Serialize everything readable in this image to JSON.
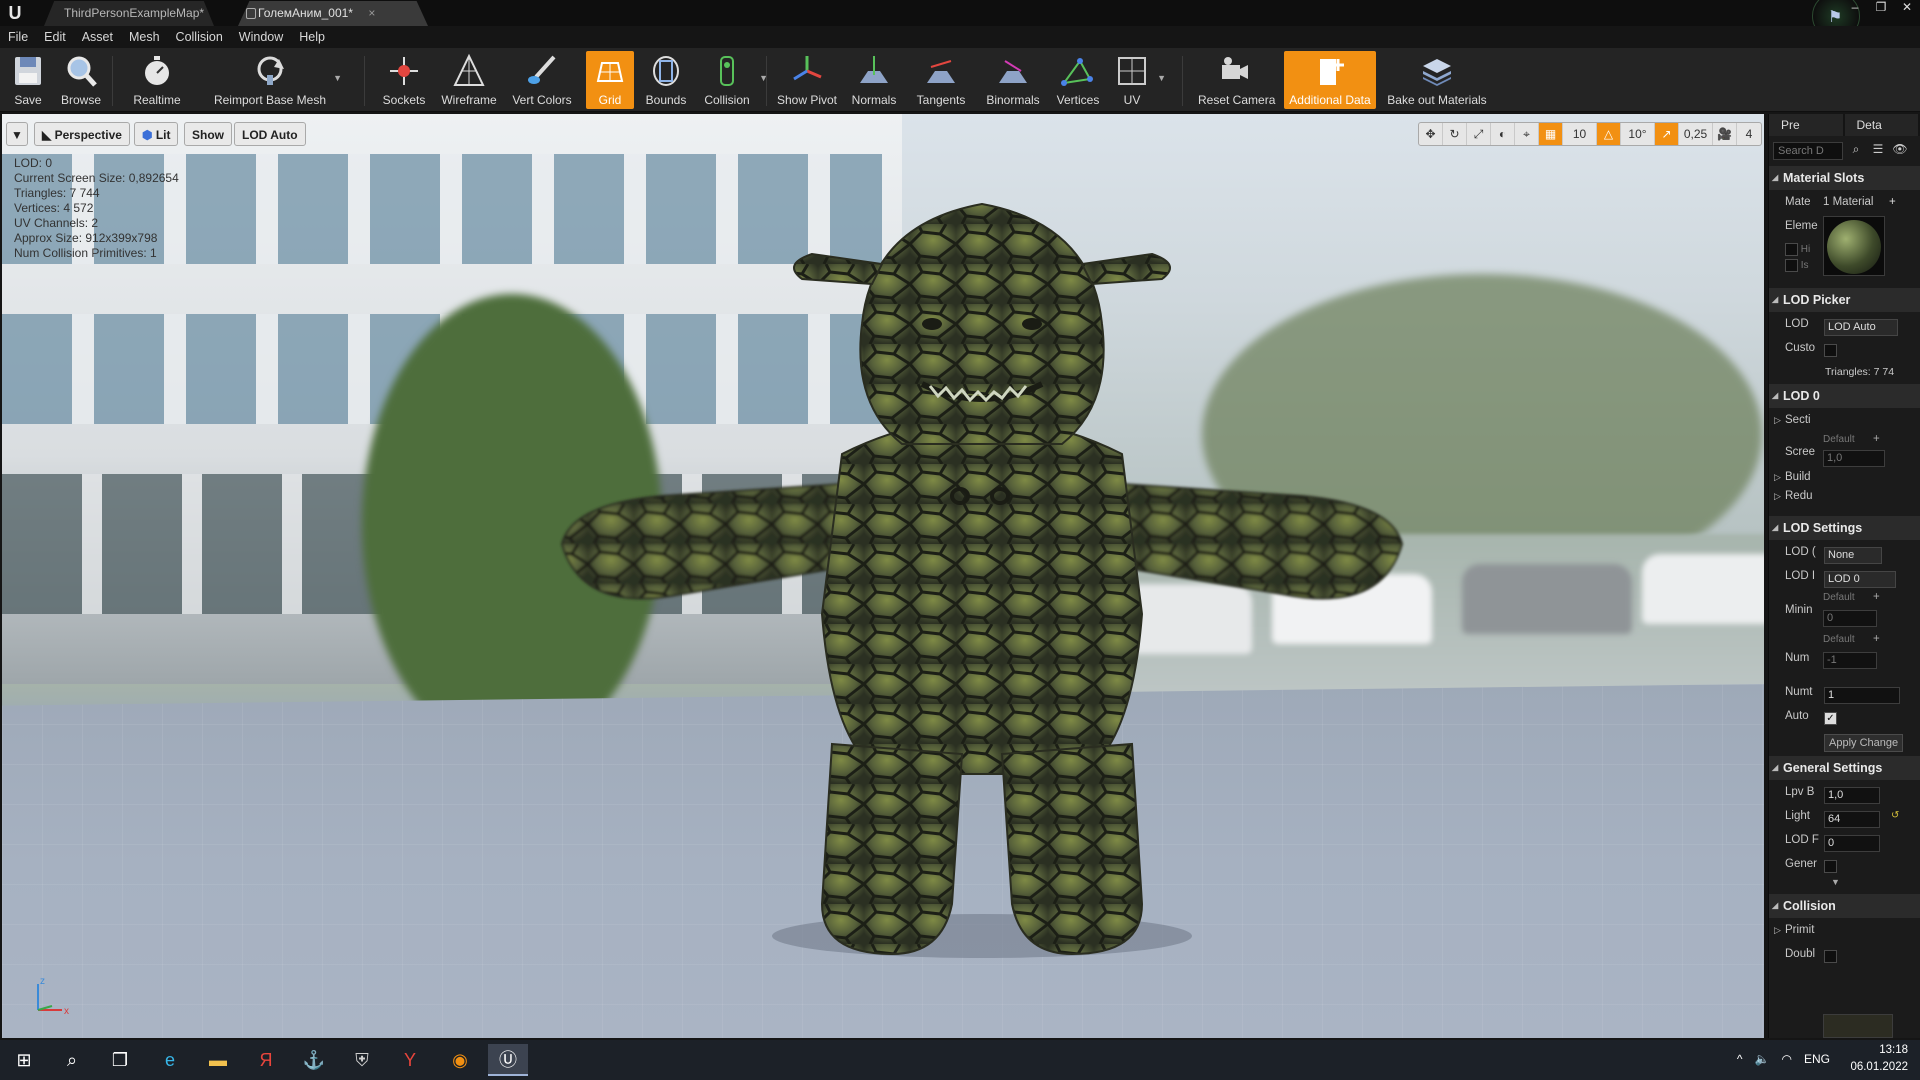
{
  "tabs": [
    {
      "label": "ThirdPersonExampleMap*"
    },
    {
      "label": "ГолемАним_001*"
    }
  ],
  "menu": [
    "File",
    "Edit",
    "Asset",
    "Mesh",
    "Collision",
    "Window",
    "Help"
  ],
  "toolbar": {
    "save": "Save",
    "browse": "Browse",
    "realtime": "Realtime",
    "reimport": "Reimport Base Mesh",
    "sockets": "Sockets",
    "wireframe": "Wireframe",
    "vert_colors": "Vert Colors",
    "grid": "Grid",
    "bounds": "Bounds",
    "collision": "Collision",
    "show_pivot": "Show Pivot",
    "normals": "Normals",
    "tangents": "Tangents",
    "binormals": "Binormals",
    "vertices": "Vertices",
    "uv": "UV",
    "reset_camera": "Reset Camera",
    "additional_data": "Additional Data",
    "bake_out": "Bake out Materials",
    "active_color": "#f29012"
  },
  "viewport": {
    "perspective": "Perspective",
    "lit": "Lit",
    "show": "Show",
    "lod_auto": "LOD Auto",
    "grid_snap": "10",
    "rot_snap": "10°",
    "scale_snap": "0,25",
    "camera_speed": "4",
    "stats": [
      "LOD:  0",
      "Current Screen Size:  0,892654",
      "Triangles:  7 744",
      "Vertices:  4 572",
      "UV Channels:  2",
      "Approx Size: 912x399x798",
      "Num Collision Primitives:  1"
    ],
    "axis_z": "z",
    "axis_x": "x"
  },
  "details": {
    "tab_preview": "Pre",
    "tab_details": "Deta",
    "search_placeholder": "Search D",
    "material_slots": "Material Slots",
    "mate_label": "Mate",
    "material_count": "1 Material",
    "elem_label": "Eleme",
    "hi_label": "Hi",
    "is_label": "Is",
    "lod_picker": "LOD Picker",
    "lod_label": "LOD",
    "lod_value": "LOD Auto",
    "custom_label": "Custo",
    "triangles": "Triangles: 7 74",
    "lod0": "LOD 0",
    "sections": "Secti",
    "screen_label": "Scree",
    "default_label": "Default",
    "screen_value": "1,0",
    "build": "Build",
    "reduce": "Redu",
    "lod_settings": "LOD Settings",
    "lod_group_label": "LOD (",
    "lod_group_value": "None",
    "lod_import_label": "LOD I",
    "lod_import_value": "LOD 0",
    "minimum_label": "Minin",
    "minimum_value": "0",
    "num_label": "Num",
    "num_value": "-1",
    "numt_label": "Numt",
    "numt_value": "1",
    "auto_label": "Auto",
    "apply_change": "Apply Change",
    "general_settings": "General Settings",
    "lpv_label": "Lpv B",
    "lpv_value": "1,0",
    "light_label": "Light",
    "light_value": "64",
    "lodf_label": "LOD F",
    "lodf_value": "0",
    "gener_label": "Gener",
    "collision": "Collision",
    "primit_label": "Primit",
    "doubl_label": "Doubl"
  },
  "taskbar": {
    "lang": "ENG",
    "time": "13:18",
    "date": "06.01.2022"
  }
}
